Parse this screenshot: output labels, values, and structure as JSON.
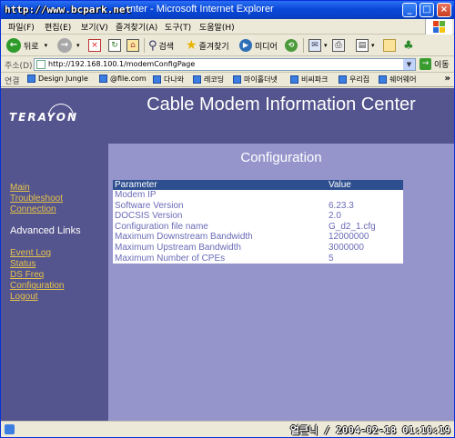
{
  "window": {
    "watermark": "http://www.bcpark.net",
    "title": "nter - Microsoft Internet Explorer"
  },
  "menu": [
    "파일(F)",
    "편집(E)",
    "보기(V)",
    "즐겨찾기(A)",
    "도구(T)",
    "도움말(H)"
  ],
  "toolbar": {
    "back": "뒤로",
    "search": "검색",
    "favorites": "즐겨찾기",
    "media": "미디어"
  },
  "address": {
    "label": "주소(D)",
    "url": "http://192.168.100.1/modemConfigPage",
    "go": "이동"
  },
  "links": {
    "label": "연결",
    "items": [
      "Design Jungle",
      "@file.com",
      "다나와",
      "레코딩",
      "마이홀더넷",
      "비씨파크",
      "우리집",
      "쉐어웨어"
    ]
  },
  "page": {
    "logo": "TERAYON",
    "headline": "Cable Modem Information Center",
    "section": "Configuration",
    "nav": {
      "main": "Main",
      "troubleshoot": "Troubleshoot",
      "connection": "Connection",
      "advanced_heading": "Advanced Links",
      "event_log": "Event Log",
      "status": "Status",
      "ds_freq": "DS Freq",
      "configuration": "Configuration",
      "logout": "Logout"
    },
    "table": {
      "col_parameter": "Parameter",
      "col_value": "Value",
      "rows": [
        {
          "param": "Modem IP",
          "value": ""
        },
        {
          "param": "Software Version",
          "value": "6.23.3"
        },
        {
          "param": "DOCSIS Version",
          "value": "2.0"
        },
        {
          "param": "Configuration file name",
          "value": "G_d2_1.cfg"
        },
        {
          "param": "Maximum Downstream Bandwidth",
          "value": "12000000"
        },
        {
          "param": "Maximum Upstream Bandwidth",
          "value": "3000000"
        },
        {
          "param": "Maximum Number of CPEs",
          "value": "5"
        }
      ]
    }
  },
  "status": {
    "stamp": "얼큰니 / 2004-02-18 01:10:19"
  },
  "colors": {
    "band": "#54548e",
    "body": "#9595cc",
    "nav_link": "#e6c44a",
    "table_header": "#2e4f8f"
  }
}
